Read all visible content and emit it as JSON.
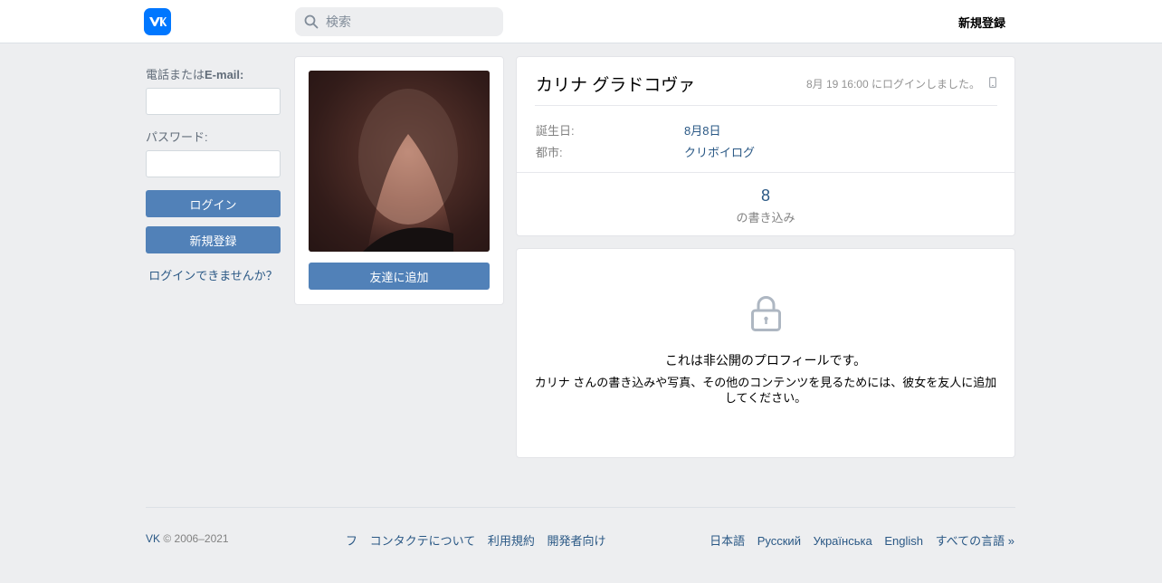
{
  "header": {
    "search_placeholder": "検索",
    "register_label": "新規登録"
  },
  "login": {
    "phone_label_prefix": "電話または",
    "phone_label_email": "E-mail:",
    "password_label": "パスワード:",
    "login_button": "ログイン",
    "register_button": "新規登録",
    "forgot_link": "ログインできませんか？"
  },
  "profile": {
    "add_friend_button": "友達に追加",
    "name": "カリナ グラドコヴァ",
    "last_seen": "8月 19 16:00 にログインしました。",
    "birthday_label": "誕生日:",
    "birthday_value": "8月8日",
    "city_label": "都市:",
    "city_value": "クリボイログ",
    "posts_count": "8",
    "posts_label": "の書き込み"
  },
  "private": {
    "title": "これは非公開のプロフィールです。",
    "description": "カリナ さんの書き込みや写真、その他のコンテンツを見るためには、彼女を友人に追加してください。"
  },
  "footer": {
    "brand": "VK",
    "copyright": " © 2006–2021",
    "links": [
      "フ",
      "コンタクテについて",
      "利用規約",
      "開発者向け"
    ],
    "languages": [
      "日本語",
      "Русский",
      "Українська",
      "English",
      "すべての言語 »"
    ]
  },
  "colors": {
    "accent": "#5181b8",
    "link": "#2a5885",
    "logo": "#0077ff",
    "background": "#edeef0"
  },
  "icons": {
    "logo": "vk-logo-icon",
    "search": "search-icon",
    "lock": "lock-icon",
    "phone": "mobile-phone-icon"
  }
}
